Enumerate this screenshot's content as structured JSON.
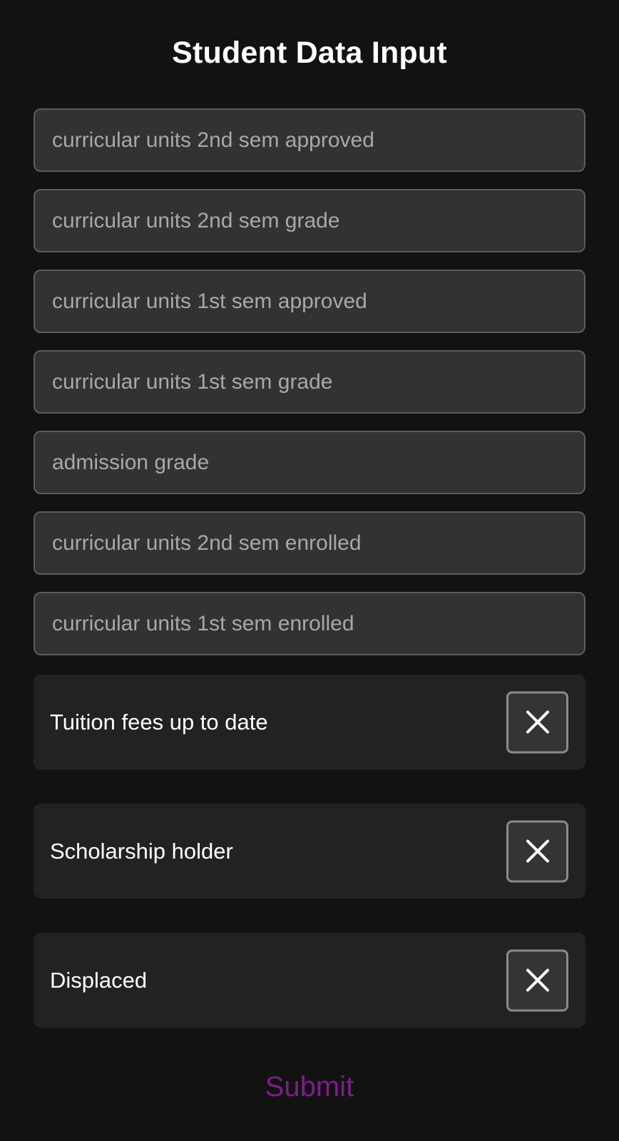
{
  "page": {
    "title": "Student Data Input"
  },
  "fields": [
    {
      "placeholder": "curricular units 2nd sem approved",
      "value": ""
    },
    {
      "placeholder": "curricular units 2nd sem grade",
      "value": ""
    },
    {
      "placeholder": "curricular units 1st sem approved",
      "value": ""
    },
    {
      "placeholder": "curricular units 1st sem grade",
      "value": ""
    },
    {
      "placeholder": "admission grade",
      "value": ""
    },
    {
      "placeholder": "curricular units 2nd sem enrolled",
      "value": ""
    },
    {
      "placeholder": "curricular units 1st sem enrolled",
      "value": ""
    }
  ],
  "toggles": [
    {
      "label": "Tuition fees up to date",
      "checked": false,
      "icon": "close-icon"
    },
    {
      "label": "Scholarship holder",
      "checked": false,
      "icon": "close-icon"
    },
    {
      "label": "Displaced",
      "checked": false,
      "icon": "close-icon"
    }
  ],
  "submit": {
    "label": "Submit",
    "color": "#7a1f86"
  },
  "colors": {
    "background": "#121212",
    "field_background": "#323232",
    "field_border": "#5c5c5c",
    "placeholder_text": "#a8a8a8",
    "toggle_row_background": "#222222",
    "toggle_box_border": "#8a8a8a",
    "text": "#ffffff"
  }
}
